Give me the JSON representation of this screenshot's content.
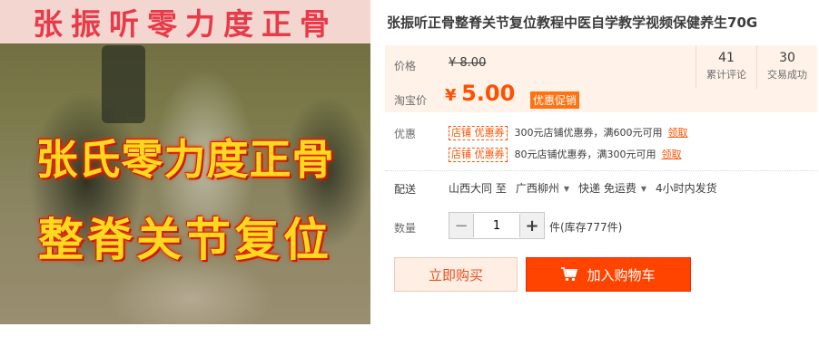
{
  "image": {
    "banner": "张振听零力度正骨",
    "caption_line1": "张氏零力度正骨",
    "caption_line2": "整脊关节复位"
  },
  "title": "张振听正骨整脊关节复位教程中医自学教学视频保健养生70G",
  "price": {
    "label": "价格",
    "original": "¥ 8.00",
    "taobao_label": "淘宝价",
    "currency": "¥",
    "current": "5.00",
    "promo_tag": "优惠促销"
  },
  "stats": [
    {
      "value": "41",
      "label": "累计评论"
    },
    {
      "value": "30",
      "label": "交易成功"
    }
  ],
  "coupons": {
    "label": "优惠",
    "items": [
      {
        "tag": "店铺 优惠券",
        "text": "300元店铺优惠券，满600元可用",
        "action": "领取"
      },
      {
        "tag": "店铺 优惠券",
        "text": "80元店铺优惠券，满300元可用",
        "action": "领取"
      }
    ]
  },
  "shipping": {
    "label": "配送",
    "from": "山西大同 至",
    "to": "广西柳州",
    "method": "快递 免运费",
    "dispatch": "4小时内发货"
  },
  "quantity": {
    "label": "数量",
    "value": "1",
    "minus": "−",
    "plus": "+",
    "stock": "件(库存777件)"
  },
  "actions": {
    "buy_now": "立即购买",
    "add_to_cart": "加入购物车"
  },
  "colors": {
    "accent": "#ff4400",
    "price": "#ff5000",
    "price_panel_bg": "#fff2e8"
  }
}
